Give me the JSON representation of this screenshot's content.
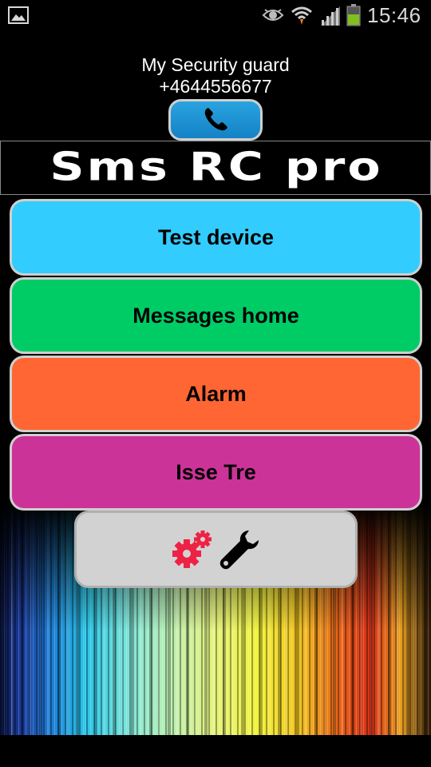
{
  "status_bar": {
    "time": "15:46",
    "icons": [
      "gallery-icon",
      "eye-icon",
      "wifi-icon",
      "signal-icon",
      "battery-icon"
    ],
    "battery_color": "#7fbf1f"
  },
  "contact": {
    "name": "My Security guard",
    "phone": "+4644556677"
  },
  "call_button": {
    "icon": "phone-icon",
    "color": "#1e90d4"
  },
  "logo": {
    "text": "Sms RC pro"
  },
  "menu": [
    {
      "label": "Test device",
      "color": "#33ccff"
    },
    {
      "label": "Messages home",
      "color": "#00cc66"
    },
    {
      "label": "Alarm",
      "color": "#ff6633"
    },
    {
      "label": "Isse Tre",
      "color": "#cc3399"
    }
  ],
  "settings_button": {
    "icons": [
      "gears-icon",
      "wrench-icon"
    ],
    "gear_color": "#ee2244"
  }
}
